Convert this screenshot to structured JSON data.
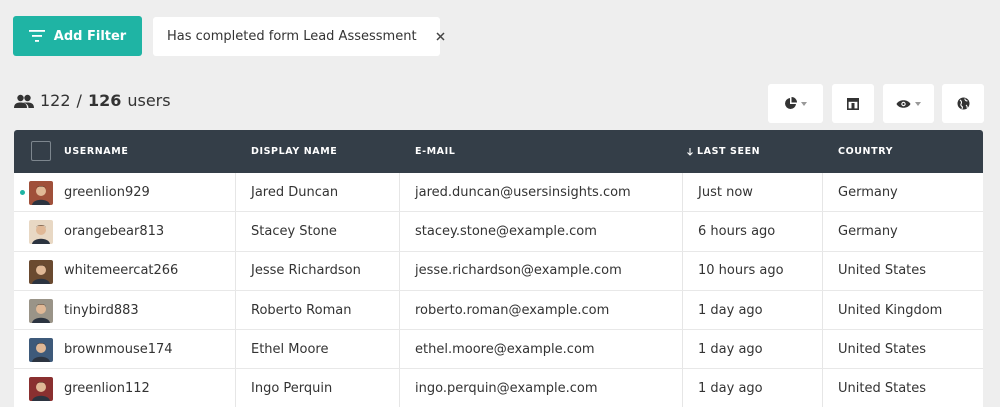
{
  "filter_bar": {
    "add_filter_label": "Add Filter",
    "active_filter_text": "Has completed form Lead Assessment"
  },
  "summary": {
    "filtered_count": "122",
    "separator": "/",
    "total_count": "126",
    "unit_label": "users"
  },
  "toolbar": {
    "icons": [
      "pie-chart-icon",
      "layout-icon",
      "eye-icon",
      "globe-icon"
    ]
  },
  "table": {
    "columns": [
      "USERNAME",
      "DISPLAY NAME",
      "E-MAIL",
      "LAST SEEN",
      "COUNTRY"
    ],
    "sorted_column": "LAST SEEN",
    "sort_direction": "descending",
    "rows": [
      {
        "username": "greenlion929",
        "display_name": "Jared Duncan",
        "email": "jared.duncan@usersinsights.com",
        "last_seen": "Just now",
        "country": "Germany",
        "online": true,
        "avatar_bg": "#a0503a"
      },
      {
        "username": "orangebear813",
        "display_name": "Stacey Stone",
        "email": "stacey.stone@example.com",
        "last_seen": "6 hours ago",
        "country": "Germany",
        "online": false,
        "avatar_bg": "#e8d8c4"
      },
      {
        "username": "whitemeercat266",
        "display_name": "Jesse Richardson",
        "email": "jesse.richardson@example.com",
        "last_seen": "10 hours ago",
        "country": "United States",
        "online": false,
        "avatar_bg": "#6a4a30"
      },
      {
        "username": "tinybird883",
        "display_name": "Roberto Roman",
        "email": "roberto.roman@example.com",
        "last_seen": "1 day ago",
        "country": "United Kingdom",
        "online": false,
        "avatar_bg": "#9a9488"
      },
      {
        "username": "brownmouse174",
        "display_name": "Ethel Moore",
        "email": "ethel.moore@example.com",
        "last_seen": "1 day ago",
        "country": "United States",
        "online": false,
        "avatar_bg": "#3e5a7a"
      },
      {
        "username": "greenlion112",
        "display_name": "Ingo Perquin",
        "email": "ingo.perquin@example.com",
        "last_seen": "1 day ago",
        "country": "United States",
        "online": false,
        "avatar_bg": "#8a3030"
      }
    ]
  },
  "colors": {
    "accent": "#1fb4a4",
    "header_bg": "#343e48",
    "page_bg": "#eeeeee"
  }
}
